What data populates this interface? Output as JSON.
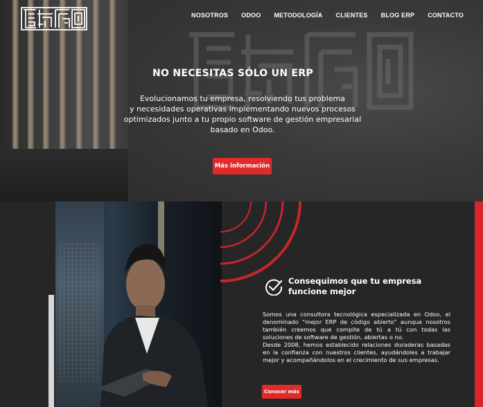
{
  "nav": {
    "logo_name": "geometric-maze-logo",
    "items": [
      "NOSOTROS",
      "ODOO",
      "METODOLOGÍA",
      "CLIENTES",
      "BLOG ERP",
      "CONTACTO"
    ]
  },
  "hero": {
    "title": "NO NECESITAS SÓLO UN ERP",
    "text_lines": [
      "Evolucionamos tu empresa, resolviendo tus problema",
      "y necesidades operativas implementando nuevos procesos",
      "optimizados junto a tu propio software de gestión empresarial",
      "basado en Odoo."
    ],
    "button_label": "Más información"
  },
  "about": {
    "icon": "check-circle-icon",
    "title": "Consequimos que tu empresa funcione mejor",
    "paragraph1": "Somos una consultora tecnológica especializada en Odoo, el denominado “mejor ERP de código abierto” aunque nosotros también creemos que compite de tú a tú con todas las soluciones de software de gestión, abiertas o no.",
    "paragraph2": "Desde 2008, hemos establecido relaciones duraderas basadas en la confianza con nuestros clientes, ayudándoles a trabajar mejor y acompañándolos en el crecimiento de sus empresas.",
    "button_label": "Conocer más"
  },
  "colors": {
    "accent": "#e12b2b",
    "background": "#262626",
    "text": "#ffffff"
  }
}
